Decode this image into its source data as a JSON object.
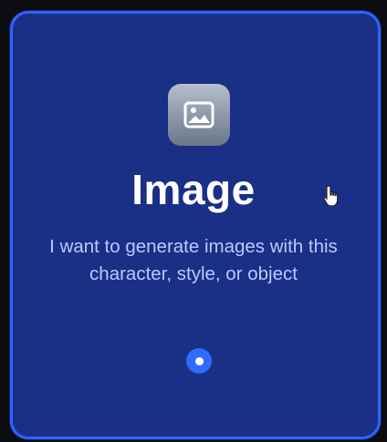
{
  "card": {
    "icon": "image-icon",
    "title": "Image",
    "description": "I want to generate images with this character, style, or object",
    "accent_color": "#2f62ff",
    "background_color": "#1a2f86"
  },
  "cursor": {
    "icon": "hand-pointer-icon"
  }
}
